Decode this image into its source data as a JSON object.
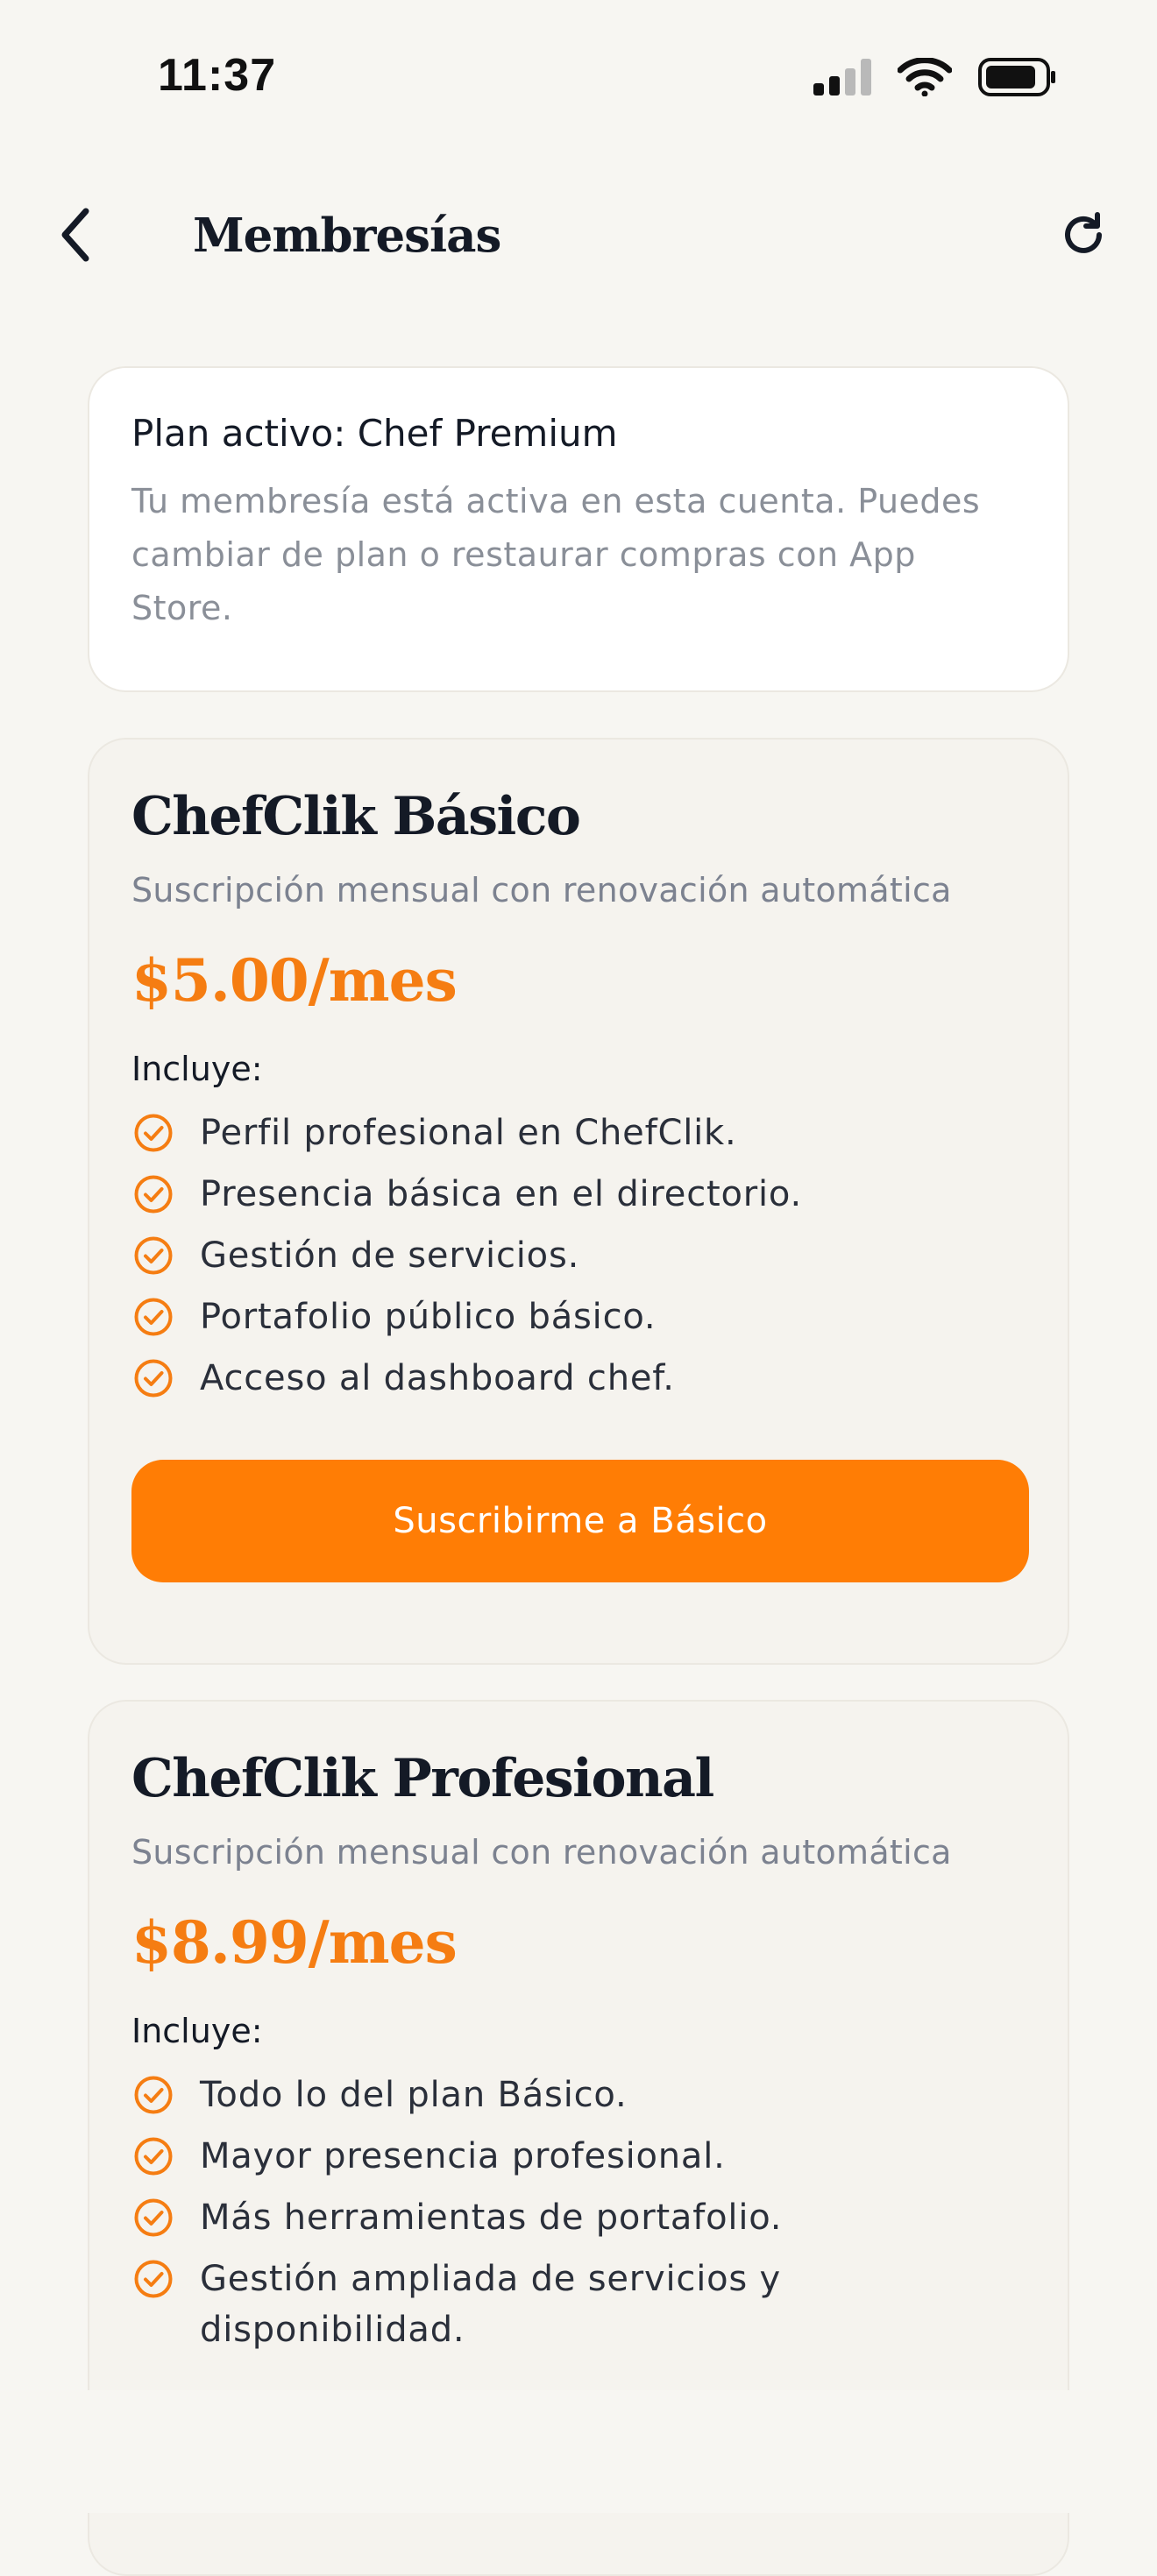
{
  "status_bar": {
    "time": "11:37"
  },
  "header": {
    "title": "Membresías"
  },
  "active_plan": {
    "title": "Plan activo: Chef Premium",
    "description": "Tu membresía está activa en esta cuenta. Puedes cambiar de plan o restaurar compras con App Store."
  },
  "plans": [
    {
      "name": "ChefClik Básico",
      "subtitle": "Suscripción mensual con renovación automática",
      "price": "$5.00/mes",
      "includes_label": "Incluye:",
      "features": [
        "Perfil profesional en ChefClik.",
        "Presencia básica en el directorio.",
        "Gestión de servicios.",
        "Portafolio público básico.",
        "Acceso al dashboard chef."
      ],
      "button_label": "Suscribirme a Básico"
    },
    {
      "name": "ChefClik Profesional",
      "subtitle": "Suscripción mensual con renovación automática",
      "price": "$8.99/mes",
      "includes_label": "Incluye:",
      "features": [
        "Todo lo del plan Básico.",
        "Mayor presencia profesional.",
        "Más herramientas de portafolio.",
        "Gestión ampliada de servicios y disponibilidad."
      ]
    }
  ],
  "icons": {
    "back": "chevron-left-icon",
    "refresh": "refresh-icon",
    "feature": "check-circle-icon",
    "signal": "cellular-signal-icon",
    "wifi": "wifi-icon",
    "battery": "battery-icon"
  },
  "colors": {
    "accent": "#ff7d05",
    "price": "#f57d12",
    "background": "#f7f6f2"
  }
}
